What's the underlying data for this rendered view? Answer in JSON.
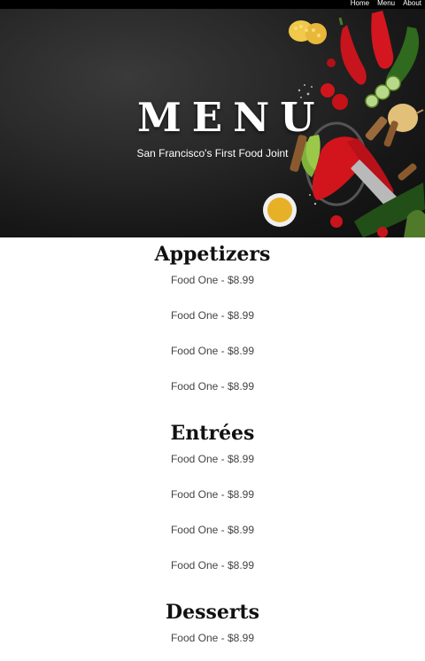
{
  "nav": {
    "links": [
      "Home",
      "Menu",
      "About"
    ]
  },
  "hero": {
    "title": "MENU",
    "subtitle": "San Francisco's First Food Joint"
  },
  "sections": [
    {
      "title": "Appetizers",
      "items": [
        "Food One - $8.99",
        "Food One - $8.99",
        "Food One - $8.99",
        "Food One - $8.99"
      ]
    },
    {
      "title": "Entrées",
      "items": [
        "Food One - $8.99",
        "Food One - $8.99",
        "Food One - $8.99",
        "Food One - $8.99"
      ]
    },
    {
      "title": "Desserts",
      "items": [
        "Food One - $8.99"
      ]
    }
  ],
  "colors": {
    "nav_bg": "#000000",
    "hero_text": "#ffffff",
    "heading": "#111111",
    "item_text": "#444444"
  }
}
